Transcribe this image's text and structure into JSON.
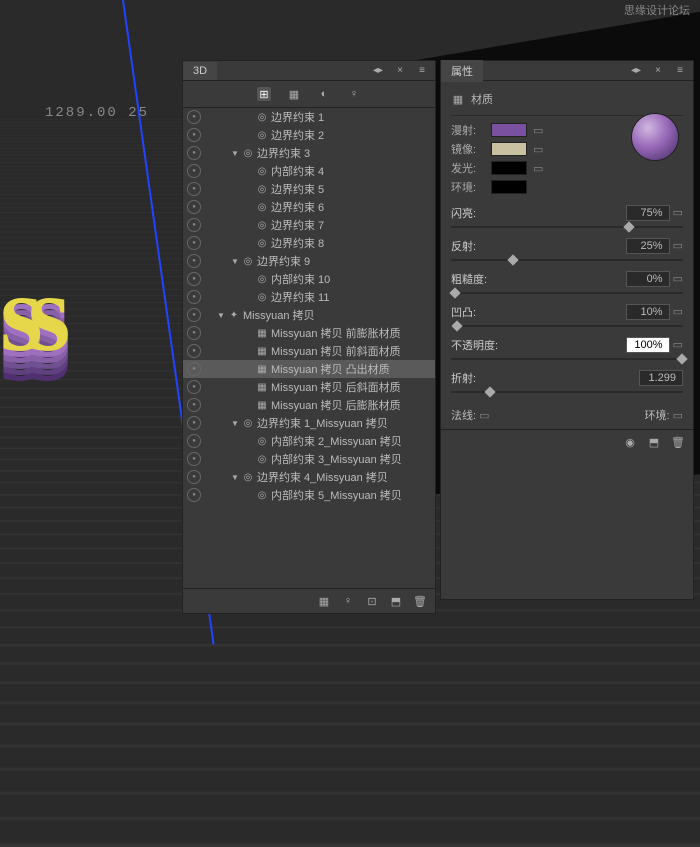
{
  "watermark": "思缘设计论坛",
  "timeline": "1289.00 25",
  "text3d": "ss",
  "panel3d": {
    "title": "3D",
    "toolbar_icons": [
      "scene-icon",
      "mesh-icon",
      "material-icon",
      "light-icon"
    ],
    "layers": [
      {
        "indent": 2,
        "arrow": "",
        "icon": "◎",
        "label": "边界约束 1"
      },
      {
        "indent": 2,
        "arrow": "",
        "icon": "◎",
        "label": "边界约束 2"
      },
      {
        "indent": 1,
        "arrow": "▼",
        "icon": "◎",
        "label": "边界约束 3"
      },
      {
        "indent": 2,
        "arrow": "",
        "icon": "◎",
        "label": "内部约束 4"
      },
      {
        "indent": 2,
        "arrow": "",
        "icon": "◎",
        "label": "边界约束 5"
      },
      {
        "indent": 2,
        "arrow": "",
        "icon": "◎",
        "label": "边界约束 6"
      },
      {
        "indent": 2,
        "arrow": "",
        "icon": "◎",
        "label": "边界约束 7"
      },
      {
        "indent": 2,
        "arrow": "",
        "icon": "◎",
        "label": "边界约束 8"
      },
      {
        "indent": 1,
        "arrow": "▼",
        "icon": "◎",
        "label": "边界约束 9"
      },
      {
        "indent": 2,
        "arrow": "",
        "icon": "◎",
        "label": "内部约束 10"
      },
      {
        "indent": 2,
        "arrow": "",
        "icon": "◎",
        "label": "边界约束 11"
      },
      {
        "indent": 0,
        "arrow": "▼",
        "icon": "✦",
        "label": "Missyuan 拷贝"
      },
      {
        "indent": 2,
        "arrow": "",
        "icon": "▦",
        "label": "Missyuan 拷贝 前膨胀材质"
      },
      {
        "indent": 2,
        "arrow": "",
        "icon": "▦",
        "label": "Missyuan 拷贝 前斜面材质"
      },
      {
        "indent": 2,
        "arrow": "",
        "icon": "▦",
        "label": "Missyuan 拷贝 凸出材质",
        "selected": true
      },
      {
        "indent": 2,
        "arrow": "",
        "icon": "▦",
        "label": "Missyuan 拷贝 后斜面材质"
      },
      {
        "indent": 2,
        "arrow": "",
        "icon": "▦",
        "label": "Missyuan 拷贝 后膨胀材质"
      },
      {
        "indent": 1,
        "arrow": "▼",
        "icon": "◎",
        "label": "边界约束 1_Missyuan 拷贝"
      },
      {
        "indent": 2,
        "arrow": "",
        "icon": "◎",
        "label": "内部约束 2_Missyuan 拷贝"
      },
      {
        "indent": 2,
        "arrow": "",
        "icon": "◎",
        "label": "内部约束 3_Missyuan 拷贝"
      },
      {
        "indent": 1,
        "arrow": "▼",
        "icon": "◎",
        "label": "边界约束 4_Missyuan 拷贝"
      },
      {
        "indent": 2,
        "arrow": "",
        "icon": "◎",
        "label": "内部约束 5_Missyuan 拷贝"
      }
    ]
  },
  "props": {
    "title": "属性",
    "material_label": "材质",
    "diffuse_label": "漫射:",
    "diffuse_color": "#7a50a0",
    "specular_label": "镜像:",
    "specular_color": "#c8c0a0",
    "glow_label": "发光:",
    "glow_color": "#000000",
    "ambient_label": "环境:",
    "ambient_color": "#000000",
    "shine_label": "闪亮:",
    "shine_value": "75%",
    "reflect_label": "反射:",
    "reflect_value": "25%",
    "rough_label": "粗糙度:",
    "rough_value": "0%",
    "bump_label": "凹凸:",
    "bump_value": "10%",
    "opacity_label": "不透明度:",
    "opacity_value": "100%",
    "refract_label": "折射:",
    "refract_value": "1.299",
    "normals_label": "法线:",
    "env_label": "环境:"
  }
}
